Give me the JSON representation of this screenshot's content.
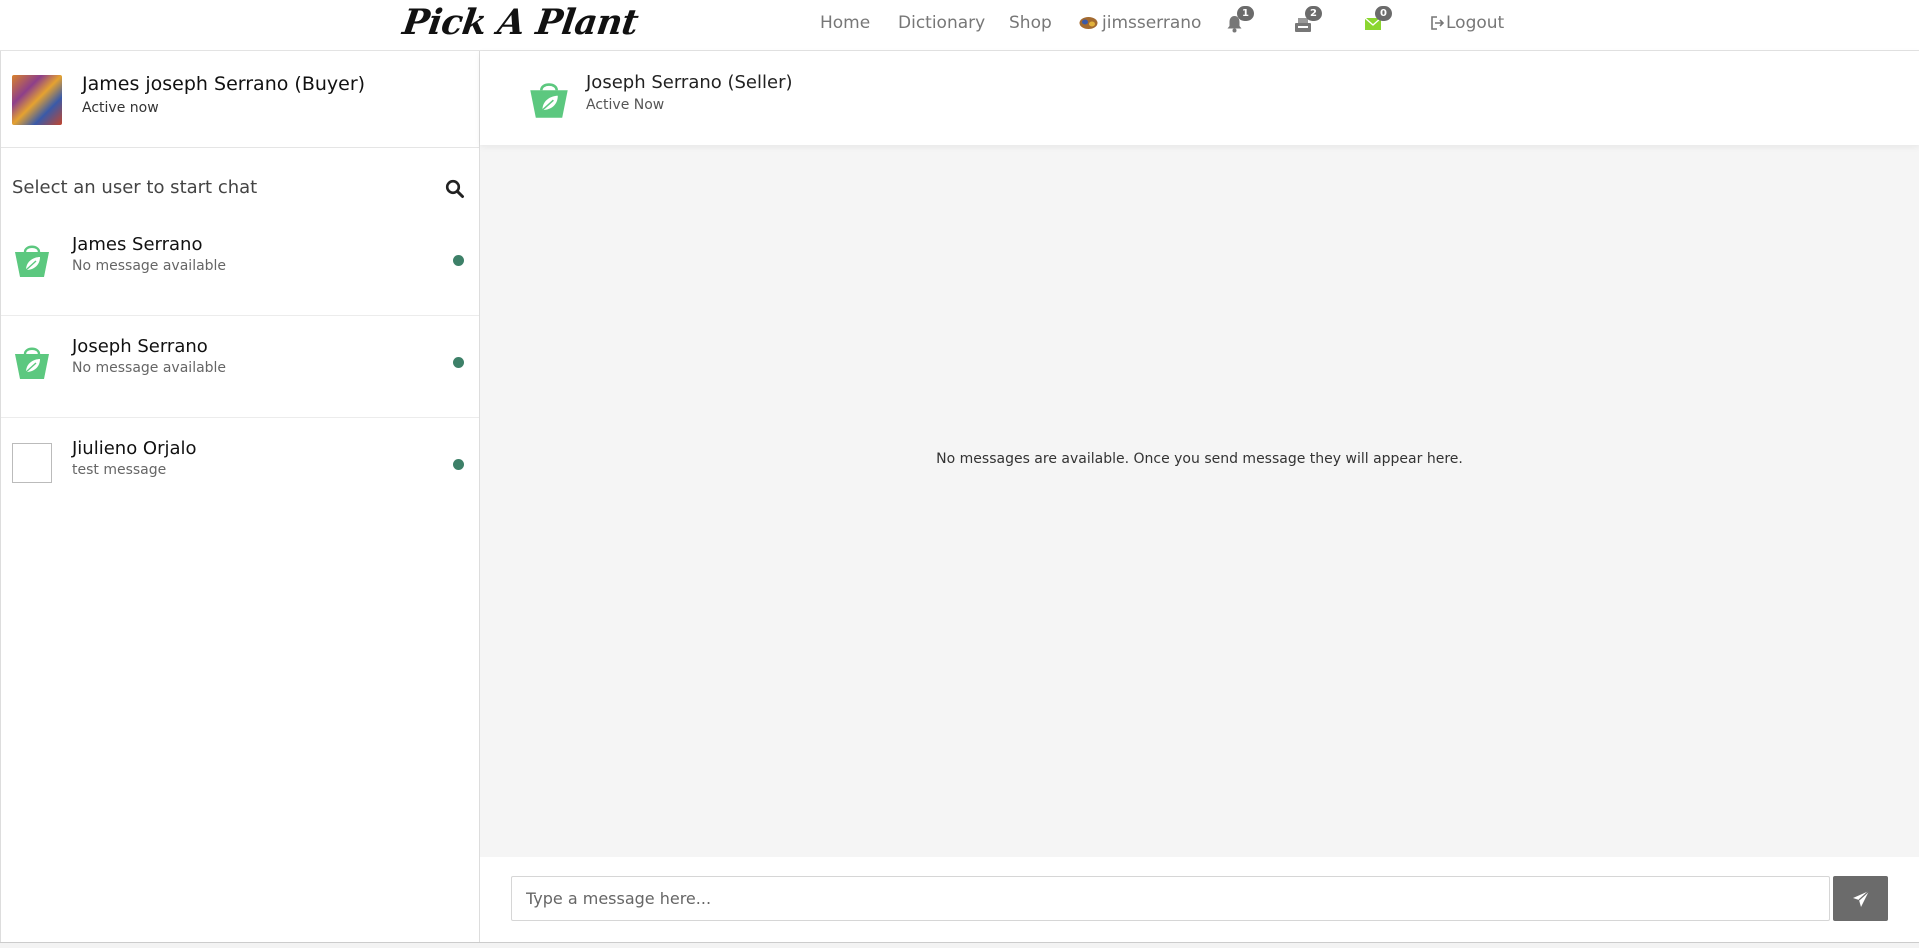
{
  "brand": "Pick A Plant",
  "nav": {
    "home": "Home",
    "dictionary": "Dictionary",
    "shop": "Shop",
    "username": "jimsserrano",
    "notifications_count": "1",
    "cart_count": "2",
    "messages_count": "0",
    "logout": "Logout",
    "icons": [
      "user-avatar-icon",
      "bell-icon",
      "cart-icon",
      "envelope-icon",
      "logout-icon"
    ]
  },
  "me": {
    "name": "James joseph Serrano (Buyer)",
    "status": "Active now"
  },
  "search": {
    "prompt": "Select an user to start chat",
    "icon": "search-icon"
  },
  "users": [
    {
      "name": "James Serrano",
      "last_message": "No message available",
      "avatar": "shopping-bag-leaf-icon",
      "online": true
    },
    {
      "name": "Joseph Serrano",
      "last_message": "No message available",
      "avatar": "shopping-bag-leaf-icon",
      "online": true
    },
    {
      "name": "Jiulieno Orjalo",
      "last_message": "test message",
      "avatar": "broken-image",
      "online": true
    }
  ],
  "chat": {
    "partner_name": "Joseph Serrano (Seller)",
    "partner_status": "Active Now",
    "empty_text": "No messages are available. Once you send message they will appear here.",
    "input_placeholder": "Type a message here...",
    "send_icon": "paper-plane-icon"
  },
  "colors": {
    "brand_green": "#5cc87f",
    "online_dot": "#3d8068",
    "send_button": "#6b6b6b",
    "chat_background": "#f5f5f5"
  }
}
